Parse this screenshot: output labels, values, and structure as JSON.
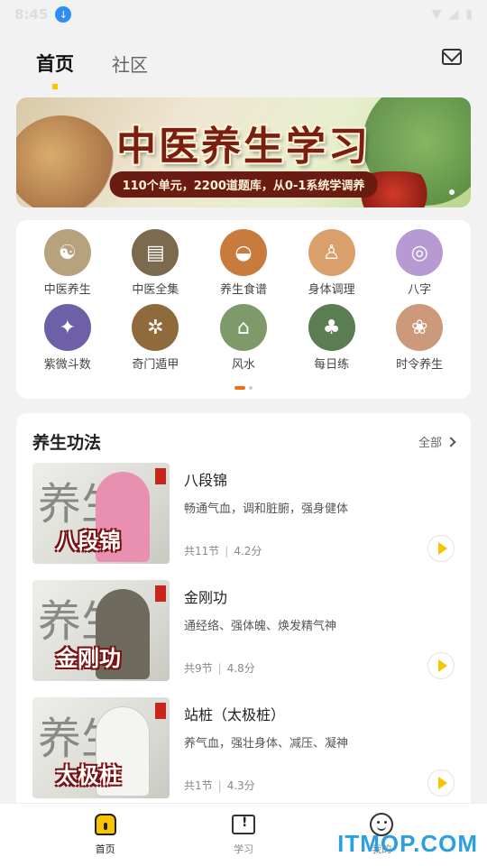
{
  "status_bar": {
    "time": "8:45"
  },
  "top_tabs": [
    {
      "label": "首页",
      "active": true
    },
    {
      "label": "社区",
      "active": false
    }
  ],
  "banner": {
    "title": "中医养生学习",
    "subtitle": "110个单元，2200道题库，从0-1系统学调养"
  },
  "categories": [
    {
      "label": "中医养生",
      "color": "#b7a27e"
    },
    {
      "label": "中医全集",
      "color": "#7c6a4e"
    },
    {
      "label": "养生食谱",
      "color": "#c77b3c"
    },
    {
      "label": "身体调理",
      "color": "#d9a06b"
    },
    {
      "label": "八字",
      "color": "#b79ad1"
    },
    {
      "label": "紫微斗数",
      "color": "#6d5fa8"
    },
    {
      "label": "奇门遁甲",
      "color": "#8f6a3a"
    },
    {
      "label": "风水",
      "color": "#7f9a6a"
    },
    {
      "label": "每日练",
      "color": "#5b7d54"
    },
    {
      "label": "时令养生",
      "color": "#cc9a7a"
    }
  ],
  "section": {
    "title": "养生功法",
    "all_label": "全部"
  },
  "courses": [
    {
      "title": "八段锦",
      "desc": "畅通气血，调和脏腑，强身健体",
      "lessons": "共11节",
      "score": "4.2分",
      "thumb_text": "八段锦",
      "figure_color": "#e98fb0"
    },
    {
      "title": "金刚功",
      "desc": "通经络、强体魄、焕发精气神",
      "lessons": "共9节",
      "score": "4.8分",
      "thumb_text": "金刚功",
      "figure_color": "#6f6a5e"
    },
    {
      "title": "站桩（太极桩）",
      "desc": "养气血，强壮身体、减压、凝神",
      "lessons": "共1节",
      "score": "4.3分",
      "thumb_text": "太极桩",
      "figure_color": "#f4f4f0"
    }
  ],
  "thumb_bg_chars": "养生",
  "bottom_nav": [
    {
      "label": "首页",
      "icon": "home-icon",
      "active": true
    },
    {
      "label": "学习",
      "icon": "study-icon",
      "active": false
    },
    {
      "label": "我的",
      "icon": "me-icon",
      "active": false
    }
  ],
  "watermark": "ITMOP.COM"
}
